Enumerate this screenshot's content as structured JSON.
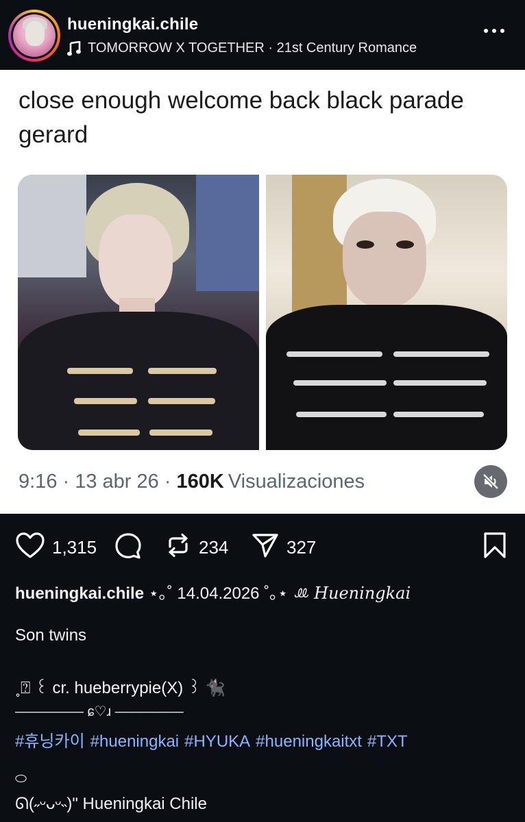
{
  "header": {
    "username": "hueningkai.chile",
    "song": "TOMORROW X TOGETHER · 21st Century Romance"
  },
  "post": {
    "tweet_text": "close enough welcome back black parade gerard",
    "time": "9:16 · 13 abr 26 ·",
    "views_count": "160K",
    "views_label": "Visualizaciones"
  },
  "actions": {
    "likes": "1,315",
    "reposts": "234",
    "shares": "327"
  },
  "caption": {
    "username": "hueningkai.chile",
    "date_line": "⋆｡˚ 14.04.2026 ˚｡⋆",
    "signature": "ꔛ Hueningkai",
    "text1": "Son twins",
    "credit": "˳⍰ ꒰ cr. hueberrypie(X) ꒱ 🐈‍⬛",
    "divider": "————— ɕ♡ɹ —————",
    "hashtags": [
      "#휴닝카이",
      "#hueningkai",
      "#HYUKA",
      "#hueningkaitxt",
      "#TXT"
    ],
    "small_mark": "⬭",
    "footer": "ᘏ(˶ᵕᴗᵕ˵)\" Hueningkai Chile"
  },
  "colors": {
    "background": "#0b0f14",
    "card": "#ffffff",
    "hashtag": "#8ab4ff"
  },
  "icons": [
    "music-note-icon",
    "more-icon",
    "mute-icon",
    "heart-icon",
    "comment-icon",
    "repost-icon",
    "share-icon",
    "bookmark-icon"
  ]
}
